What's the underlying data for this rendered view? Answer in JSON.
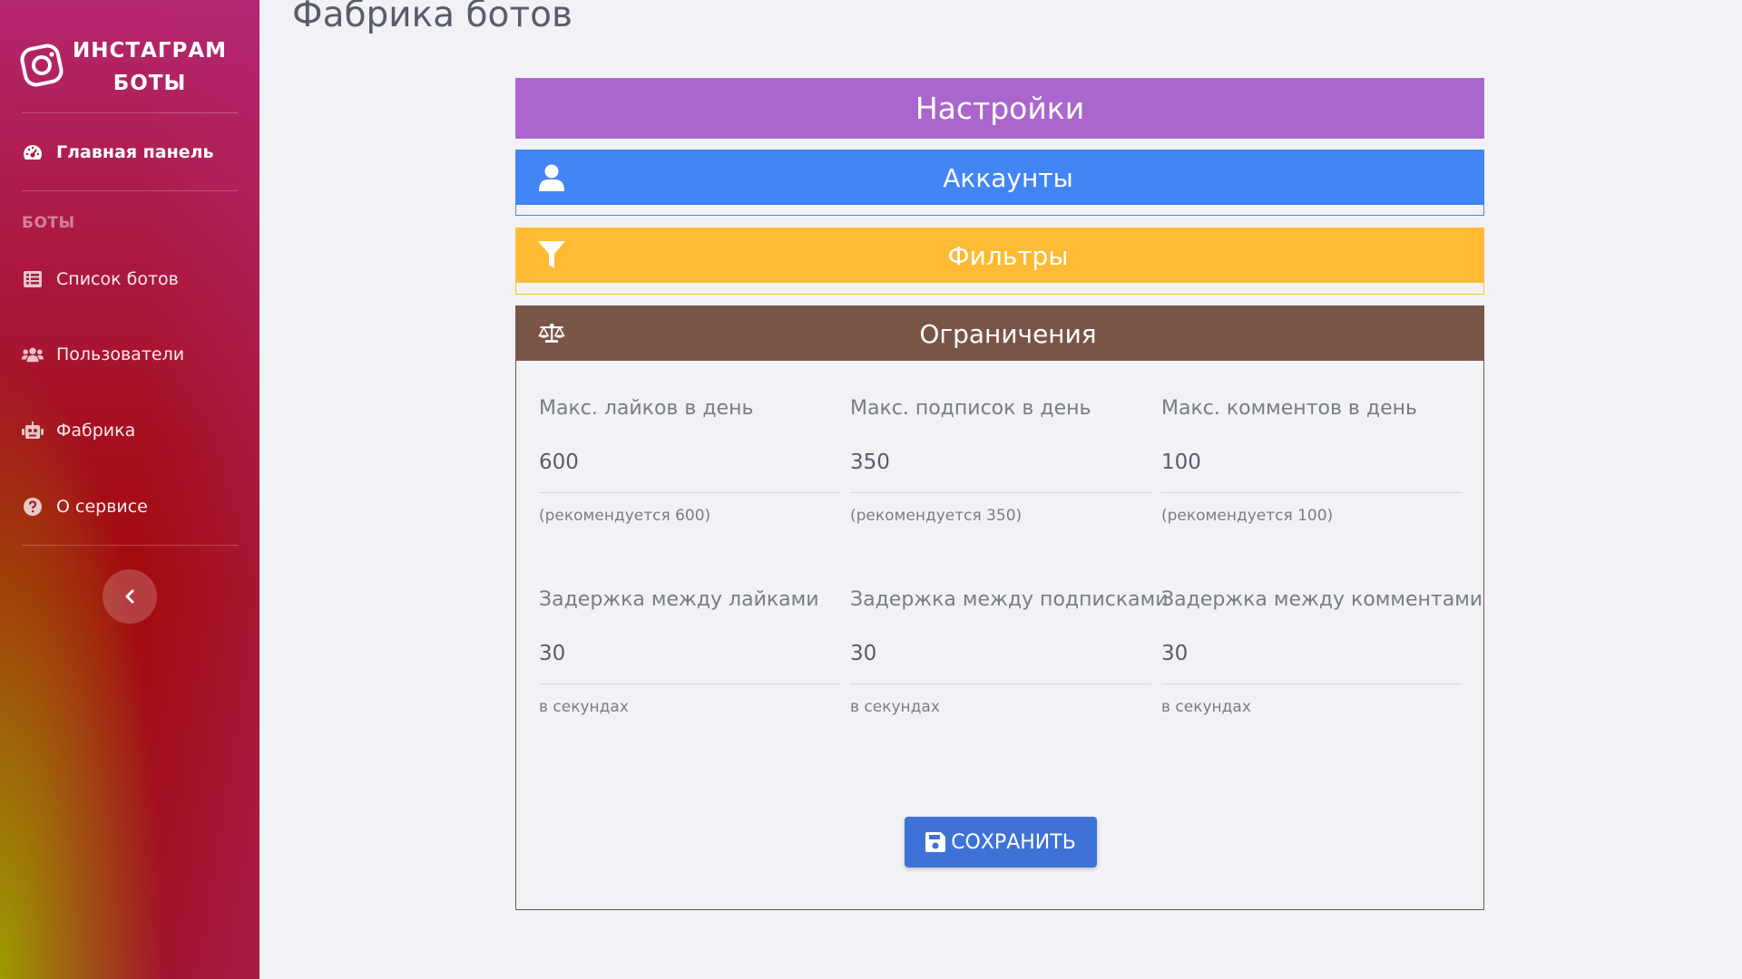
{
  "sidebar": {
    "brand": {
      "line1": "ИНСТАГРАМ",
      "line2": "БОТЫ"
    },
    "items": [
      {
        "label": "Главная панель",
        "icon": "tachometer-icon",
        "active": true
      },
      {
        "label": "Список ботов",
        "icon": "list-icon"
      },
      {
        "label": "Пользователи",
        "icon": "users-icon"
      },
      {
        "label": "Фабрика",
        "icon": "robot-icon"
      },
      {
        "label": "О сервисе",
        "icon": "question-circle-icon"
      }
    ],
    "section_heading": "БОТЫ",
    "collapse_icon": "chevron-left-icon"
  },
  "page": {
    "title": "Фабрика ботов"
  },
  "settings": {
    "title": "Настройки",
    "color": "#aa66cc"
  },
  "accounts": {
    "title": "Аккаунты",
    "icon": "user-icon",
    "color": "#4285f4"
  },
  "filters": {
    "title": "Фильтры",
    "icon": "filter-icon",
    "color": "#ffbb33"
  },
  "limits": {
    "title": "Ограничения",
    "icon": "balance-scale-icon",
    "color": "#795548",
    "fields": [
      {
        "label": "Макс. лайков в день",
        "value": "600",
        "help": "(рекомендуется 600)"
      },
      {
        "label": "Макс. подписок в день",
        "value": "350",
        "help": "(рекомендуется 350)"
      },
      {
        "label": "Макс. комментов в день",
        "value": "100",
        "help": "(рекомендуется 100)"
      },
      {
        "label": "Задержка между лайками",
        "value": "30",
        "help": "в секундах"
      },
      {
        "label": "Задержка между подписками",
        "value": "30",
        "help": "в секундах"
      },
      {
        "label": "Задержка между комментами",
        "value": "30",
        "help": "в секундах"
      }
    ],
    "save_label": "СОХРАНИТЬ",
    "save_icon": "save-icon"
  }
}
